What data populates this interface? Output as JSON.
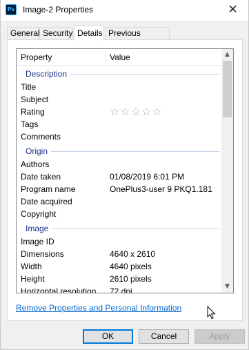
{
  "window": {
    "title": "Image-2 Properties",
    "app_icon_text": "Ps",
    "close_symbol": "✕"
  },
  "tabs": [
    {
      "label": "General"
    },
    {
      "label": "Security"
    },
    {
      "label": "Details",
      "active": true
    },
    {
      "label": "Previous Versions"
    }
  ],
  "list": {
    "header": {
      "property": "Property",
      "value": "Value"
    },
    "groups": {
      "description": "Description",
      "origin": "Origin",
      "image": "Image"
    },
    "rows": {
      "title": {
        "p": "Title",
        "v": ""
      },
      "subject": {
        "p": "Subject",
        "v": ""
      },
      "rating": {
        "p": "Rating",
        "stars": "☆☆☆☆☆"
      },
      "tags": {
        "p": "Tags",
        "v": ""
      },
      "comments": {
        "p": "Comments",
        "v": ""
      },
      "authors": {
        "p": "Authors",
        "v": ""
      },
      "date_taken": {
        "p": "Date taken",
        "v": "01/08/2019 6:01 PM"
      },
      "program_name": {
        "p": "Program name",
        "v": "OnePlus3-user 9 PKQ1.181..."
      },
      "date_acquired": {
        "p": "Date acquired",
        "v": ""
      },
      "copyright": {
        "p": "Copyright",
        "v": ""
      },
      "image_id": {
        "p": "Image ID",
        "v": ""
      },
      "dimensions": {
        "p": "Dimensions",
        "v": "4640 x 2610"
      },
      "width": {
        "p": "Width",
        "v": "4640 pixels"
      },
      "height": {
        "p": "Height",
        "v": "2610 pixels"
      },
      "h_resolution": {
        "p": "Horizontal resolution",
        "v": "72 dpi"
      }
    },
    "scroll_up": "▲",
    "scroll_down": "▼"
  },
  "link": "Remove Properties and Personal Information",
  "buttons": {
    "ok": "OK",
    "cancel": "Cancel",
    "apply": "Apply"
  }
}
